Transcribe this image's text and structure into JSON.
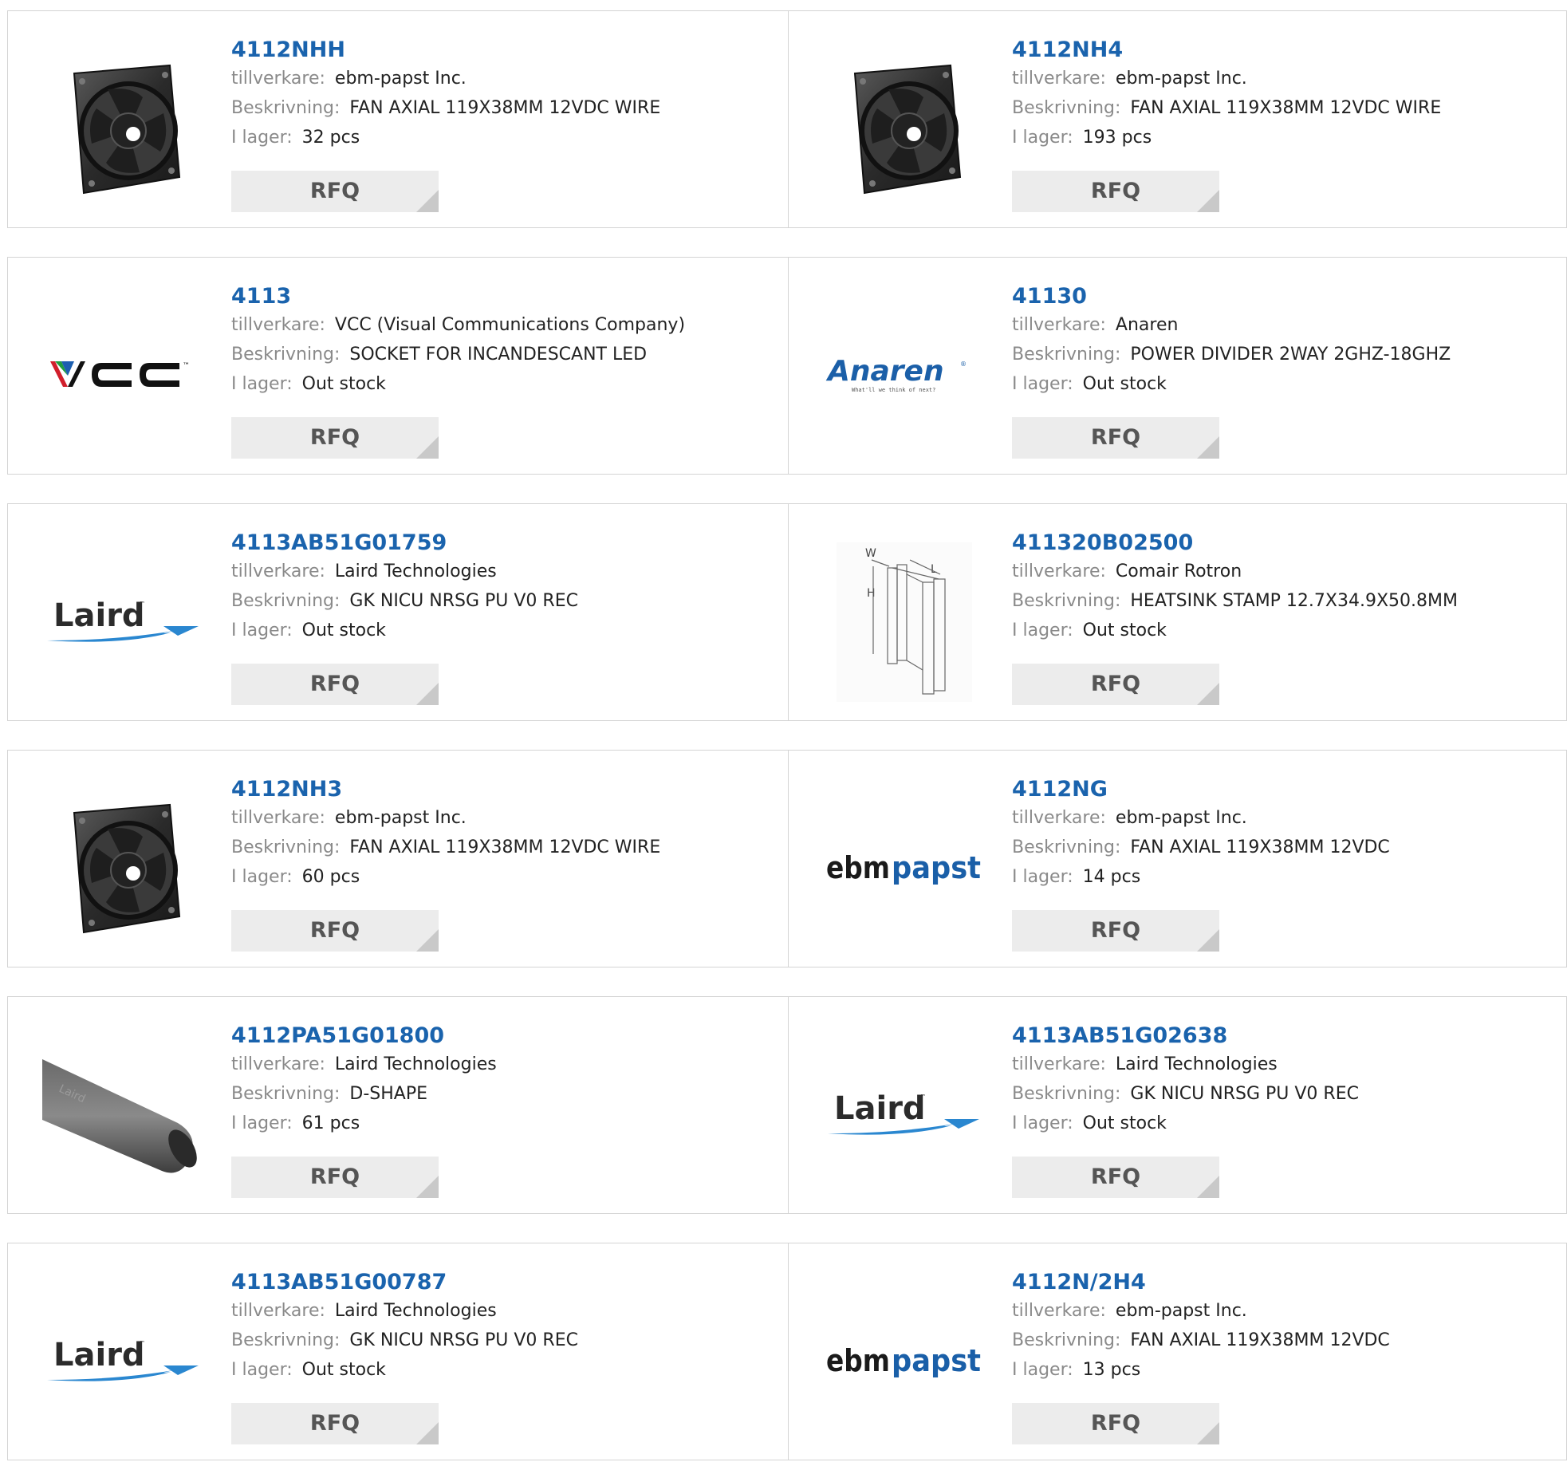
{
  "labels": {
    "manufacturer": "tillverkare:",
    "description": "Beskrivning:",
    "stock": "I lager:",
    "rfq": "RFQ"
  },
  "products": [
    {
      "part": "4112NHH",
      "manufacturer": "ebm-papst Inc.",
      "description": "FAN AXIAL 119X38MM 12VDC WIRE",
      "stock": "32 pcs",
      "image": "fan-photo"
    },
    {
      "part": "4112NH4",
      "manufacturer": "ebm-papst Inc.",
      "description": "FAN AXIAL 119X38MM 12VDC WIRE",
      "stock": "193 pcs",
      "image": "fan-photo"
    },
    {
      "part": "4113",
      "manufacturer": "VCC (Visual Communications Company)",
      "description": "SOCKET FOR INCANDESCANT LED",
      "stock": "Out stock",
      "image": "vcc-logo"
    },
    {
      "part": "41130",
      "manufacturer": "Anaren",
      "description": "POWER DIVIDER 2WAY 2GHZ-18GHZ",
      "stock": "Out stock",
      "image": "anaren-logo"
    },
    {
      "part": "4113AB51G01759",
      "manufacturer": "Laird Technologies",
      "description": "GK NICU NRSG PU V0 REC",
      "stock": "Out stock",
      "image": "laird-logo"
    },
    {
      "part": "411320B02500",
      "manufacturer": "Comair Rotron",
      "description": "HEATSINK STAMP 12.7X34.9X50.8MM",
      "stock": "Out stock",
      "image": "heatsink-drawing"
    },
    {
      "part": "4112NH3",
      "manufacturer": "ebm-papst Inc.",
      "description": "FAN AXIAL 119X38MM 12VDC WIRE",
      "stock": "60 pcs",
      "image": "fan-photo"
    },
    {
      "part": "4112NG",
      "manufacturer": "ebm-papst Inc.",
      "description": "FAN AXIAL 119X38MM 12VDC",
      "stock": "14 pcs",
      "image": "ebmpapst-logo"
    },
    {
      "part": "4112PA51G01800",
      "manufacturer": "Laird Technologies",
      "description": "D-SHAPE",
      "stock": "61 pcs",
      "image": "tube-photo"
    },
    {
      "part": "4113AB51G02638",
      "manufacturer": "Laird Technologies",
      "description": "GK NICU NRSG PU V0 REC",
      "stock": "Out stock",
      "image": "laird-logo"
    },
    {
      "part": "4113AB51G00787",
      "manufacturer": "Laird Technologies",
      "description": "GK NICU NRSG PU V0 REC",
      "stock": "Out stock",
      "image": "laird-logo"
    },
    {
      "part": "4112N/2H4",
      "manufacturer": "ebm-papst Inc.",
      "description": "FAN AXIAL 119X38MM 12VDC",
      "stock": "13 pcs",
      "image": "ebmpapst-logo"
    }
  ],
  "logos": {
    "vcc": "VCC",
    "vcc_tm": "™",
    "anaren": "Anaren",
    "anaren_reg": "®",
    "anaren_tagline": "What'll we think of next?",
    "laird": "Laird",
    "laird_tm": "™",
    "ebm": "ebm",
    "papst": "papst",
    "heatsink_w": "W",
    "heatsink_l": "L",
    "heatsink_h": "H",
    "tube_print": "Laird"
  },
  "colors": {
    "link": "#1a63ad",
    "label": "#8a8a8a",
    "button_bg": "#ececec",
    "border": "#d4d4d4"
  }
}
